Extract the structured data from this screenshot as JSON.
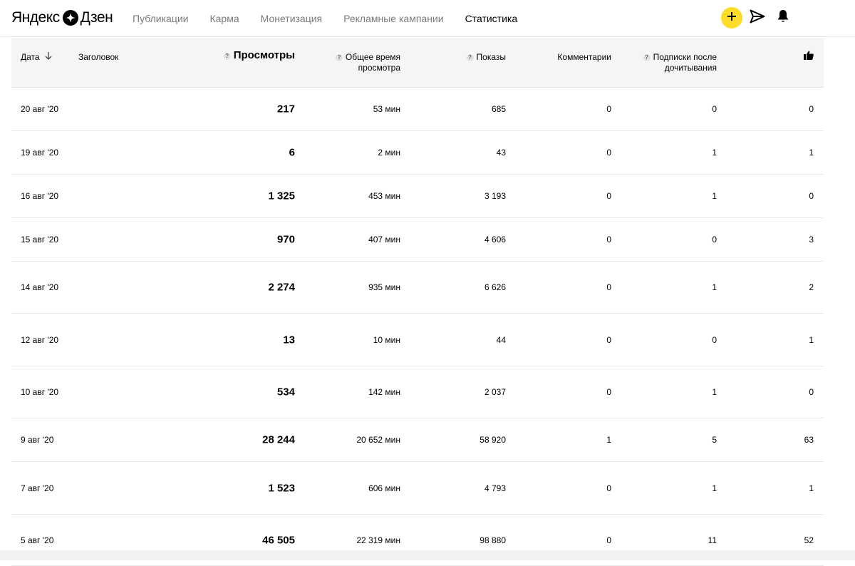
{
  "header": {
    "logo_left": "Яндекс",
    "logo_right": "Дзен",
    "nav": [
      {
        "label": "Публикации",
        "active": false
      },
      {
        "label": "Карма",
        "active": false
      },
      {
        "label": "Монетизация",
        "active": false
      },
      {
        "label": "Рекламные кампании",
        "active": false
      },
      {
        "label": "Статистика",
        "active": true
      }
    ],
    "actions": [
      "plus-icon",
      "send-icon",
      "bell-icon"
    ],
    "accent_color": "#ffdb2a"
  },
  "table": {
    "columns": {
      "date": "Дата",
      "title": "Заголовок",
      "views": "Просмотры",
      "time_line1": "Общее время",
      "time_line2": "просмотра",
      "shows": "Показы",
      "comments": "Комментарии",
      "subs_line1": "Подписки после",
      "subs_line2": "дочитывания",
      "likes_icon": "thumbs-up-icon",
      "help_mark": "?"
    },
    "rows": [
      {
        "date": "20 авг '20",
        "views": "217",
        "time": "53 мин",
        "shows": "685",
        "comments": "0",
        "subs": "0",
        "likes": "0"
      },
      {
        "date": "19 авг '20",
        "views": "6",
        "time": "2 мин",
        "shows": "43",
        "comments": "0",
        "subs": "1",
        "likes": "1"
      },
      {
        "date": "16 авг '20",
        "views": "1 325",
        "time": "453 мин",
        "shows": "3 193",
        "comments": "0",
        "subs": "1",
        "likes": "0"
      },
      {
        "date": "15 авг '20",
        "views": "970",
        "time": "407 мин",
        "shows": "4 606",
        "comments": "0",
        "subs": "0",
        "likes": "3"
      },
      {
        "date": "14 авг '20",
        "views": "2 274",
        "time": "935 мин",
        "shows": "6 626",
        "comments": "0",
        "subs": "1",
        "likes": "2"
      },
      {
        "date": "12 авг '20",
        "views": "13",
        "time": "10 мин",
        "shows": "44",
        "comments": "0",
        "subs": "0",
        "likes": "1"
      },
      {
        "date": "10 авг '20",
        "views": "534",
        "time": "142 мин",
        "shows": "2 037",
        "comments": "0",
        "subs": "1",
        "likes": "0"
      },
      {
        "date": "9 авг '20",
        "views": "28 244",
        "time": "20 652 мин",
        "shows": "58 920",
        "comments": "1",
        "subs": "5",
        "likes": "63"
      },
      {
        "date": "7 авг '20",
        "views": "1 523",
        "time": "606 мин",
        "shows": "4 793",
        "comments": "0",
        "subs": "1",
        "likes": "1"
      },
      {
        "date": "5 авг '20",
        "views": "46 505",
        "time": "22 319 мин",
        "shows": "98 880",
        "comments": "0",
        "subs": "11",
        "likes": "52"
      }
    ]
  }
}
